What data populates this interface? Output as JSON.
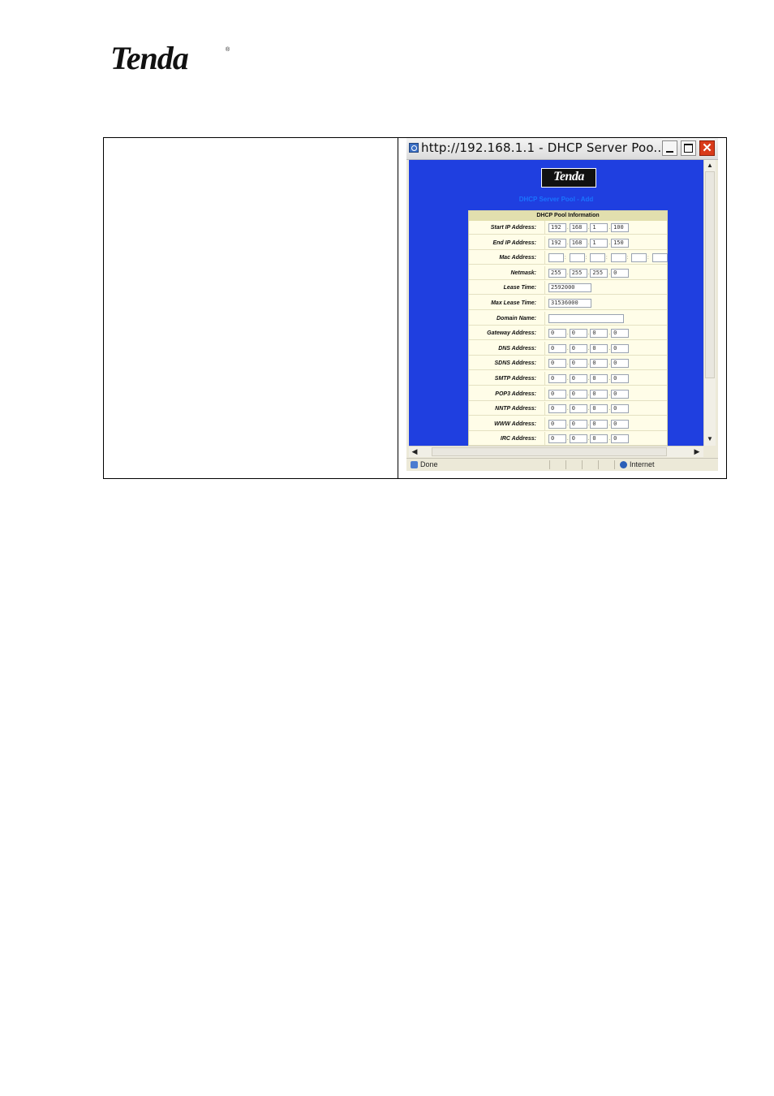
{
  "doc": {
    "logo_text": "Tenda",
    "logo_mark": "®"
  },
  "window": {
    "title": "http://192.168.1.1 - DHCP Server Poo...",
    "close_glyph": "✕",
    "logo_text": "Tenda",
    "page_title": "DHCP Server Pool - Add",
    "status_left": "Done",
    "status_zone": "Internet"
  },
  "form": {
    "header": "DHCP Pool Information",
    "rows": [
      {
        "label": "Start IP Address:",
        "values": [
          "192",
          "168",
          "1",
          "100"
        ]
      },
      {
        "label": "End IP Address:",
        "values": [
          "192",
          "168",
          "1",
          "150"
        ]
      },
      {
        "label": "Mac Address:",
        "values": [
          "",
          "",
          "",
          "",
          "",
          ""
        ]
      },
      {
        "label": "Netmask:",
        "values": [
          "255",
          "255",
          "255",
          "0"
        ]
      },
      {
        "label": "Lease Time:",
        "values": [
          "2592000"
        ]
      },
      {
        "label": "Max Lease Time:",
        "values": [
          "31536000"
        ]
      },
      {
        "label": "Domain Name:",
        "values": [
          ""
        ]
      },
      {
        "label": "Gateway Address:",
        "values": [
          "0",
          "0",
          "0",
          "0"
        ]
      },
      {
        "label": "DNS Address:",
        "values": [
          "0",
          "0",
          "0",
          "0"
        ]
      },
      {
        "label": "SDNS Address:",
        "values": [
          "0",
          "0",
          "0",
          "0"
        ]
      },
      {
        "label": "SMTP Address:",
        "values": [
          "0",
          "0",
          "0",
          "0"
        ]
      },
      {
        "label": "POP3 Address:",
        "values": [
          "0",
          "0",
          "0",
          "0"
        ]
      },
      {
        "label": "NNTP Address:",
        "values": [
          "0",
          "0",
          "0",
          "0"
        ]
      },
      {
        "label": "WWW Address:",
        "values": [
          "0",
          "0",
          "0",
          "0"
        ]
      },
      {
        "label": "IRC Address:",
        "values": [
          "0",
          "0",
          "0",
          "0"
        ]
      }
    ]
  }
}
